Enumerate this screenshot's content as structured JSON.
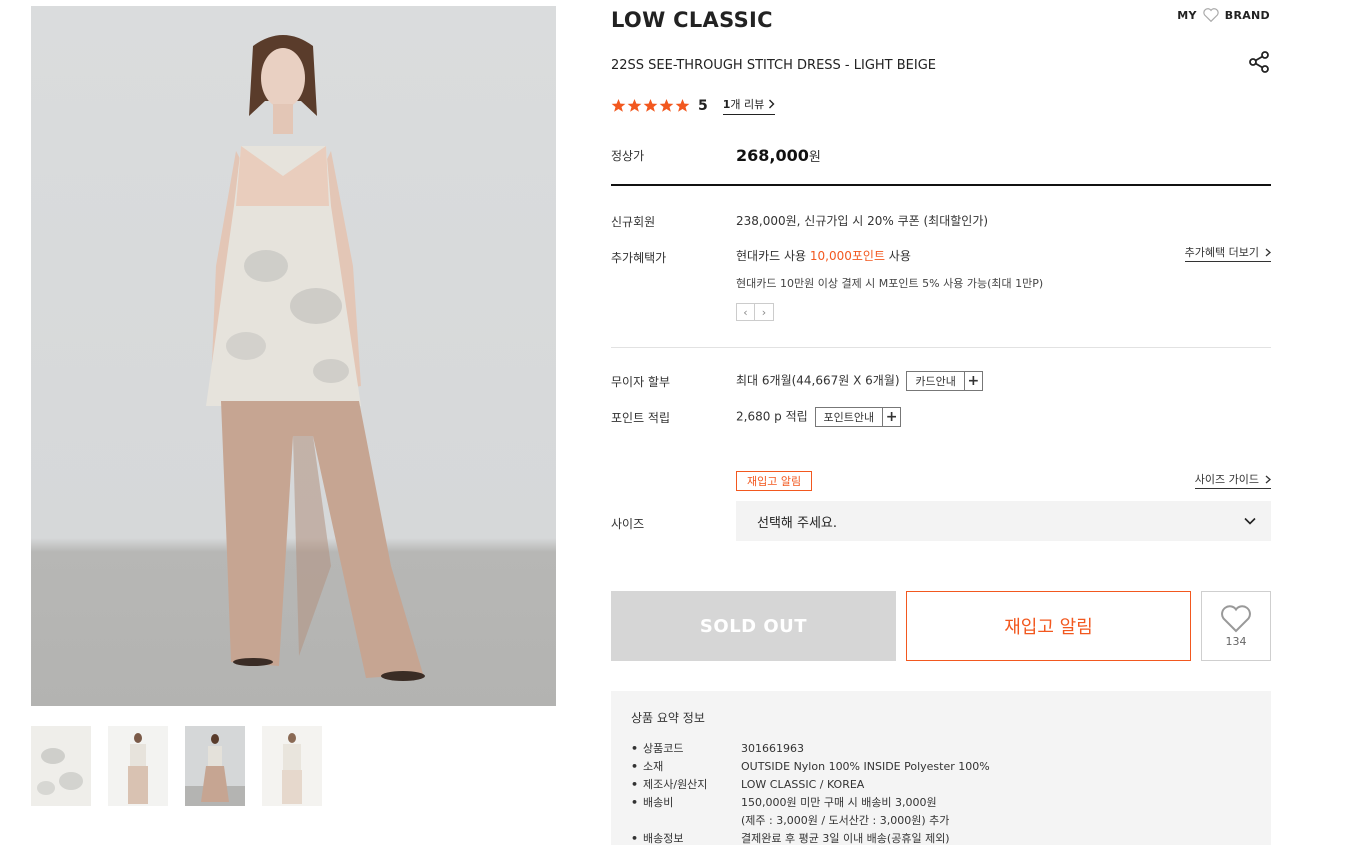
{
  "header": {
    "my_label": "MY",
    "brand_label": "BRAND"
  },
  "product": {
    "brand": "LOW CLASSIC",
    "name": "22SS SEE-THROUGH STITCH DRESS - LIGHT BEIGE",
    "rating_score": "5",
    "rating": 5,
    "review_count_num": "1",
    "review_count_suffix": "개 리뷰"
  },
  "price": {
    "label": "정상가",
    "value": "268,000",
    "unit": "원"
  },
  "member": {
    "label": "신규회원",
    "text": "238,000원, 신규가입 시 20% 쿠폰 (최대할인가)"
  },
  "benefit": {
    "label": "추가혜택가",
    "line_prefix": "현대카드 사용 ",
    "line_highlight": "10,000포인트",
    "line_suffix": " 사용",
    "sub_line": "현대카드 10만원 이상 결제 시 M포인트 5% 사용 가능(최대 1만P)",
    "more_link": "추가혜택 더보기",
    "prev_arrow": "‹",
    "next_arrow": "›"
  },
  "installment": {
    "label": "무이자 할부",
    "text": "최대 6개월(44,667원 X 6개월)",
    "button": "카드안내",
    "plus": "+"
  },
  "points": {
    "label": "포인트 적립",
    "text": "2,680 p 적립",
    "button": "포인트안내",
    "plus": "+"
  },
  "size": {
    "badge": "재입고 알림",
    "guide_link": "사이즈 가이드",
    "label": "사이즈",
    "placeholder": "선택해 주세요."
  },
  "actions": {
    "soldout": "SOLD OUT",
    "restock": "재입고 알림",
    "like_count": "134"
  },
  "summary": {
    "title": "상품 요약 정보",
    "rows": [
      {
        "key": "상품코드",
        "value": "301661963"
      },
      {
        "key": "소재",
        "value": "OUTSIDE Nylon 100% INSIDE Polyester 100%"
      },
      {
        "key": "제조사/원산지",
        "value": "LOW CLASSIC / KOREA"
      },
      {
        "key": "배송비",
        "value": "150,000원 미만 구매 시 배송비 3,000원"
      },
      {
        "key": "",
        "value": "(제주 : 3,000원 / 도서산간 : 3,000원) 추가"
      },
      {
        "key": "배송정보",
        "value": "결제완료 후 평균 3일 이내 배송(공휴일 제외)"
      }
    ]
  },
  "colors": {
    "accent": "#f2581f",
    "star": "#f2581f",
    "soldout_bg": "#d6d6d6"
  },
  "icons": [
    "heart-icon",
    "share-icon",
    "star-icon",
    "chevron-right-icon",
    "chevron-down-icon",
    "plus-icon"
  ]
}
